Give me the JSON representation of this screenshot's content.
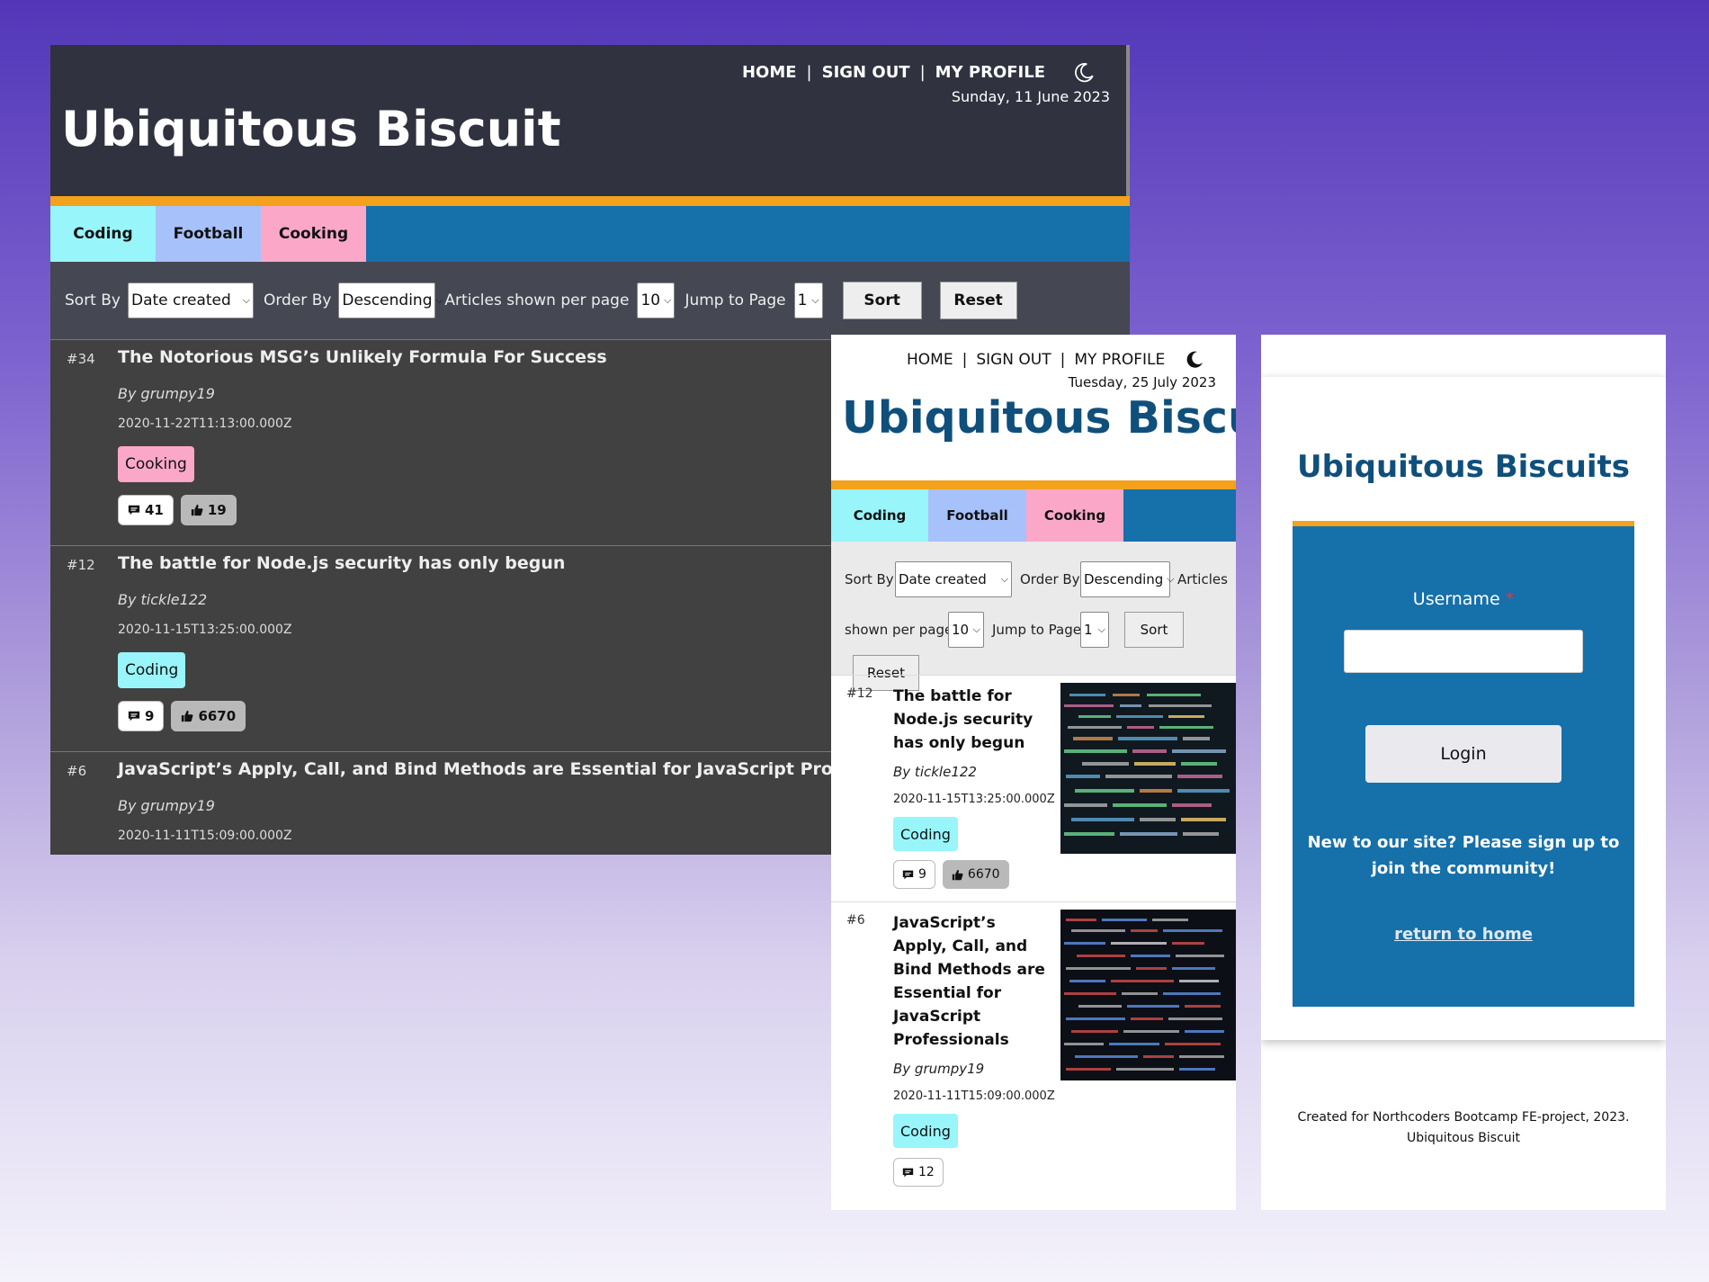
{
  "dark": {
    "nav": {
      "home": "HOME",
      "sign_out": "SIGN OUT",
      "my_profile": "MY PROFILE",
      "sep": "|"
    },
    "date": "Sunday, 11 June 2023",
    "title": "Ubiquitous Biscuit",
    "topics": [
      "Coding",
      "Football",
      "Cooking"
    ],
    "sort": {
      "sort_by_label": "Sort By",
      "sort_by_value": "Date created",
      "order_by_label": "Order By",
      "order_by_value": "Descending",
      "per_page_label": "Articles shown per page",
      "per_page_value": "10",
      "jump_label": "Jump to Page",
      "jump_value": "1",
      "sort_button": "Sort",
      "reset_button": "Reset"
    },
    "articles": [
      {
        "num": "#34",
        "title": "The Notorious MSG’s Unlikely Formula For Success",
        "author": "By grumpy19",
        "created": "2020-11-22T11:13:00.000Z",
        "topic": "Cooking",
        "comments": "41",
        "votes": "19"
      },
      {
        "num": "#12",
        "title": "The battle for Node.js security has only begun",
        "author": "By tickle122",
        "created": "2020-11-15T13:25:00.000Z",
        "topic": "Coding",
        "comments": "9",
        "votes": "6670"
      },
      {
        "num": "#6",
        "title": "JavaScript’s Apply, Call, and Bind Methods are Essential for JavaScript Professionals",
        "author": "By grumpy19",
        "created": "2020-11-11T15:09:00.000Z"
      }
    ]
  },
  "light": {
    "nav": {
      "home": "HOME",
      "sign_out": "SIGN OUT",
      "my_profile": "MY PROFILE",
      "sep": "|"
    },
    "date": "Tuesday, 25 July 2023",
    "title": "Ubiquitous Biscuit",
    "topics": [
      "Coding",
      "Football",
      "Cooking"
    ],
    "sort": {
      "sort_by_label": "Sort By",
      "sort_by_value": "Date created",
      "order_by_label": "Order By",
      "order_by_value": "Descending",
      "per_page_label_1": "Articles",
      "per_page_label_2": "shown per page",
      "per_page_value": "10",
      "jump_label": "Jump to Page",
      "jump_value": "1",
      "sort_button": "Sort",
      "reset_button": "Reset"
    },
    "articles": [
      {
        "num": "#12",
        "title": "The battle for Node.js security has only begun",
        "author": "By tickle122",
        "created": "2020-11-15T13:25:00.000Z",
        "topic": "Coding",
        "comments": "9",
        "votes": "6670"
      },
      {
        "num": "#6",
        "title": "JavaScript’s Apply, Call, and Bind Methods are Essential for JavaScript Professionals",
        "author": "By grumpy19",
        "created": "2020-11-11T15:09:00.000Z",
        "topic": "Coding",
        "comments": "12"
      }
    ]
  },
  "login": {
    "title": "Ubiquitous Biscuits",
    "username_label": "Username",
    "required_mark": "*",
    "login_button": "Login",
    "signup_text": "New to our site? Please sign up to join the community!",
    "return_link": "return to home",
    "footer_line1": "Created for Northcoders Bootcamp FE-project, 2023.",
    "footer_line2": "Ubiquitous Biscuit"
  },
  "colors": {
    "coding": "#98f5fa",
    "football": "#a7c1fa",
    "cooking": "#fba8c8",
    "topic_bar": "#1670aa",
    "accent_orange": "#f4a21c",
    "title_blue": "#0f4f7c",
    "dark_header": "#30323f"
  },
  "icons": [
    "moon-icon",
    "comment-icon",
    "thumbs-up-icon",
    "chevron-down-icon"
  ]
}
